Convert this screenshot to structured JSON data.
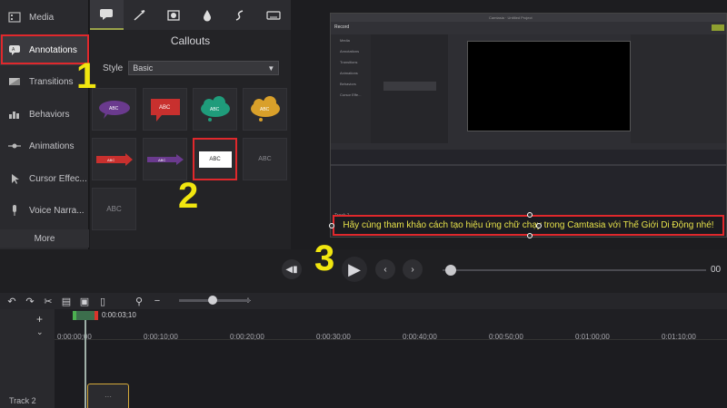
{
  "sidebar": {
    "items": [
      {
        "label": "Media",
        "icon": "media-icon"
      },
      {
        "label": "Annotations",
        "icon": "annotations-icon"
      },
      {
        "label": "Transitions",
        "icon": "transitions-icon"
      },
      {
        "label": "Behaviors",
        "icon": "behaviors-icon"
      },
      {
        "label": "Animations",
        "icon": "animations-icon"
      },
      {
        "label": "Cursor Effec...",
        "icon": "cursor-icon"
      },
      {
        "label": "Voice Narra...",
        "icon": "microphone-icon"
      }
    ],
    "more_label": "More"
  },
  "panel": {
    "title": "Callouts",
    "style_label": "Style",
    "style_value": "Basic",
    "callouts": [
      "ABC",
      "ABC",
      "ABC",
      "ABC",
      "ABC",
      "ABC",
      "ABC",
      "ABC",
      "ABC"
    ]
  },
  "inner_app": {
    "title": "Camtasia · Untitled Project",
    "record_label": "Record",
    "side_items": [
      "Media",
      "Annotations",
      "Transitions",
      "Animations",
      "Behaviors",
      "Cursor Effe..."
    ],
    "track_label": "Track 1"
  },
  "preview": {
    "caption": "Hãy cùng tham khảo cách tạo hiệu ứng chữ chạy trong Camtasia với Thế Giới Di Động nhé!"
  },
  "controls": {
    "time_end": "00"
  },
  "timeline": {
    "playhead_time": "0:00:03;10",
    "ticks": [
      "0:00:00;00",
      "0:00:10;00",
      "0:00:20;00",
      "0:00:30;00",
      "0:00:40;00",
      "0:00:50;00",
      "0:01:00;00",
      "0:01:10;00"
    ],
    "track_label": "Track 2"
  },
  "markers": {
    "one": "1",
    "two": "2",
    "three": "3"
  },
  "colors": {
    "highlight": "#e0282c",
    "marker": "#f1e60f",
    "caption_text": "#e6e14a"
  }
}
